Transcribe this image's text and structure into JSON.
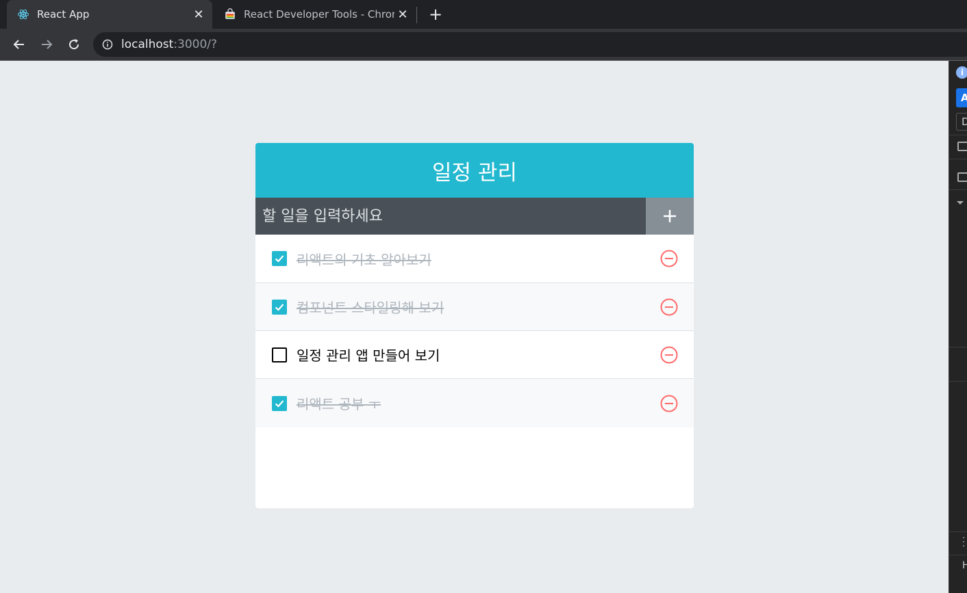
{
  "browser": {
    "tabs": [
      {
        "title": "React App",
        "active": true,
        "icon": "react-logo-icon"
      },
      {
        "title": "React Developer Tools - Chrome Web Store",
        "active": false,
        "icon": "chrome-web-store-icon"
      }
    ],
    "url_host": "localhost",
    "url_rest": ":3000/?"
  },
  "app": {
    "title": "일정 관리",
    "input_placeholder": "할 일을 입력하세요",
    "todos": [
      {
        "text": "리액트의 기초 알아보기",
        "checked": true
      },
      {
        "text": "컴포넌트 스타일링해 보기",
        "checked": true
      },
      {
        "text": "일정 관리 앱 만들어 보기",
        "checked": false
      },
      {
        "text": "리액트 공부 ㅜ",
        "checked": true
      }
    ]
  },
  "devtools": {
    "a_label": "A",
    "d_label": "D",
    "h_label": "H"
  },
  "colors": {
    "accent": "#22b8cf",
    "remove": "#ff6b6b",
    "insert_bg": "#495057"
  }
}
